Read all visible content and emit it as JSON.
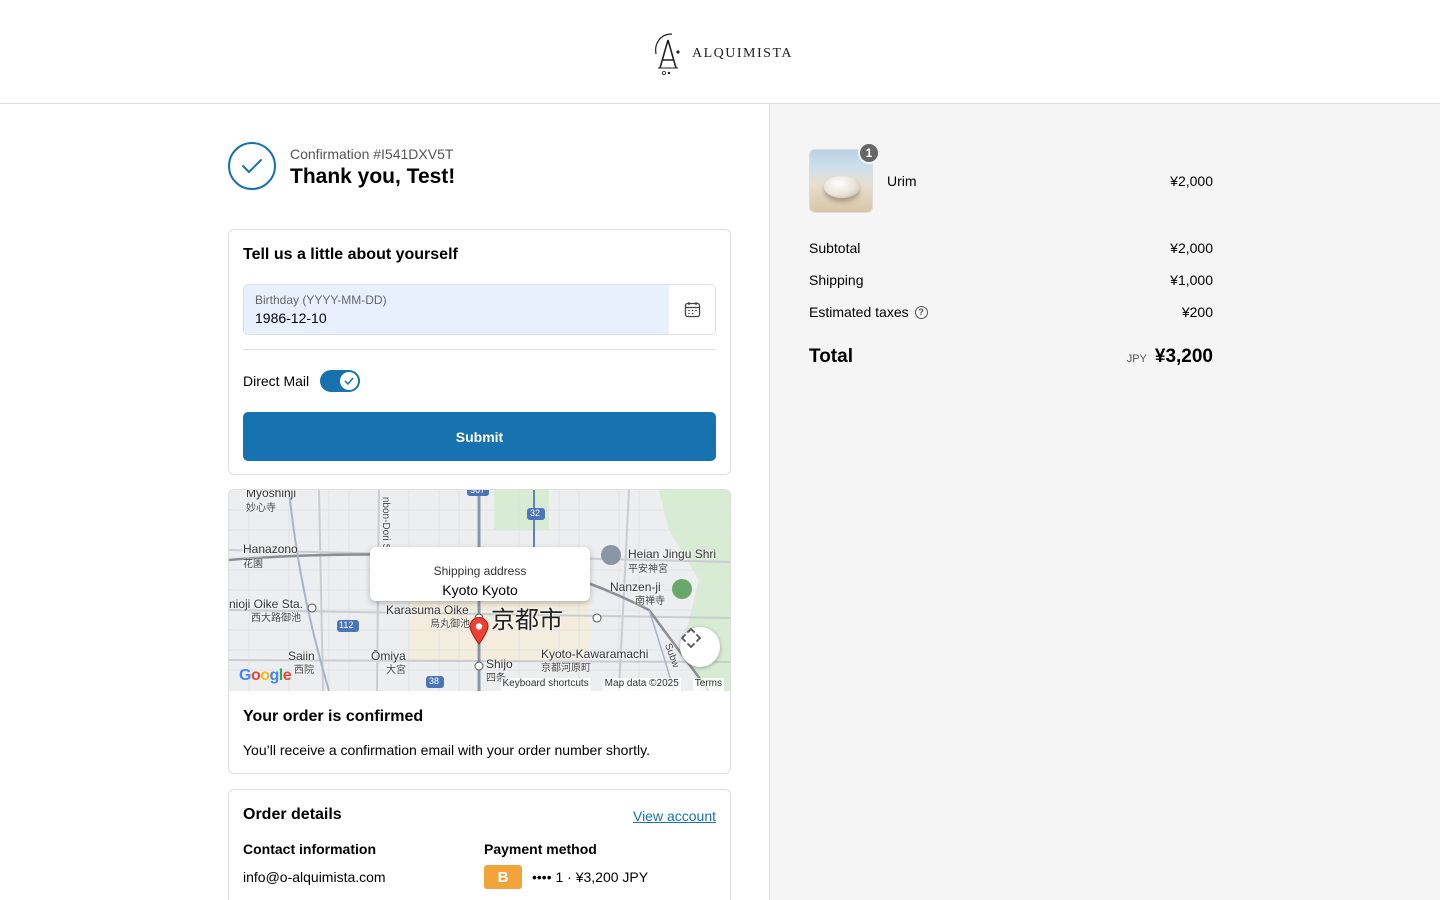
{
  "brand": {
    "name": "ALQUIMISTA"
  },
  "confirmation": {
    "number": "Confirmation #I541DXV5T",
    "title": "Thank you, Test!"
  },
  "about": {
    "title": "Tell us a little about yourself",
    "birthday_label": "Birthday (YYYY-MM-DD)",
    "birthday_value": "1986-12-10",
    "direct_mail_label": "Direct Mail",
    "direct_mail_on": true,
    "submit_label": "Submit"
  },
  "map": {
    "popup_title": "Shipping address",
    "popup_address": "Kyoto Kyoto",
    "labels": {
      "myoshinji": "Myoshinji",
      "myoshinji_jp": "妙心寺",
      "hanazono": "Hanazono",
      "hanazono_jp": "花園",
      "nishioji": "nioji Oike Sta.",
      "nishioji_jp": "西大路御池",
      "karasuma": "Karasuma Oike",
      "karasuma_jp": "烏丸御池",
      "kyoto_city": "京都市",
      "heian": "Heian Jingu Shri",
      "heian_jp": "平安神宮",
      "nanzenji": "Nanzen-ji",
      "nanzenji_jp": "南禅寺",
      "saiin": "Saiin",
      "saiin_jp": "西院",
      "omiya": "Ōmiya",
      "omiya_jp": "大宮",
      "shijo": "Shijo",
      "shijo_jp": "四条",
      "kawaramachi": "Kyoto-Kawaramachi",
      "kawaramachi_jp": "京都河原町",
      "senbon": "nbon-Dori S",
      "subway": "Subw",
      "route_32": "32",
      "route_112": "112",
      "route_38": "38",
      "route_367": "367"
    },
    "google": "Google",
    "keyboard_shortcuts": "Keyboard shortcuts",
    "map_data": "Map data ©2025",
    "terms": "Terms"
  },
  "order_confirmed": {
    "title": "Your order is confirmed",
    "message": "You’ll receive a confirmation email with your order number shortly."
  },
  "order_details": {
    "title": "Order details",
    "view_account": "View account",
    "contact_heading": "Contact information",
    "contact_email": "info@o-alquimista.com",
    "payment_heading": "Payment method",
    "payment_badge": "B",
    "payment_text": "•••• 1 · ¥3,200 JPY"
  },
  "summary": {
    "item": {
      "name": "Urim",
      "price": "¥2,000",
      "quantity": "1"
    },
    "subtotal_label": "Subtotal",
    "subtotal": "¥2,000",
    "shipping_label": "Shipping",
    "shipping": "¥1,000",
    "taxes_label": "Estimated taxes",
    "taxes": "¥200",
    "total_label": "Total",
    "currency": "JPY",
    "total": "¥3,200"
  },
  "colors": {
    "accent": "#1773b0",
    "summary_bg": "#f5f5f5",
    "payment_badge": "#f0a43a"
  },
  "icons": [
    "logo-icon",
    "check-icon",
    "calendar-icon",
    "toggle-check-icon",
    "map-pin-icon",
    "fullscreen-icon",
    "help-icon"
  ]
}
